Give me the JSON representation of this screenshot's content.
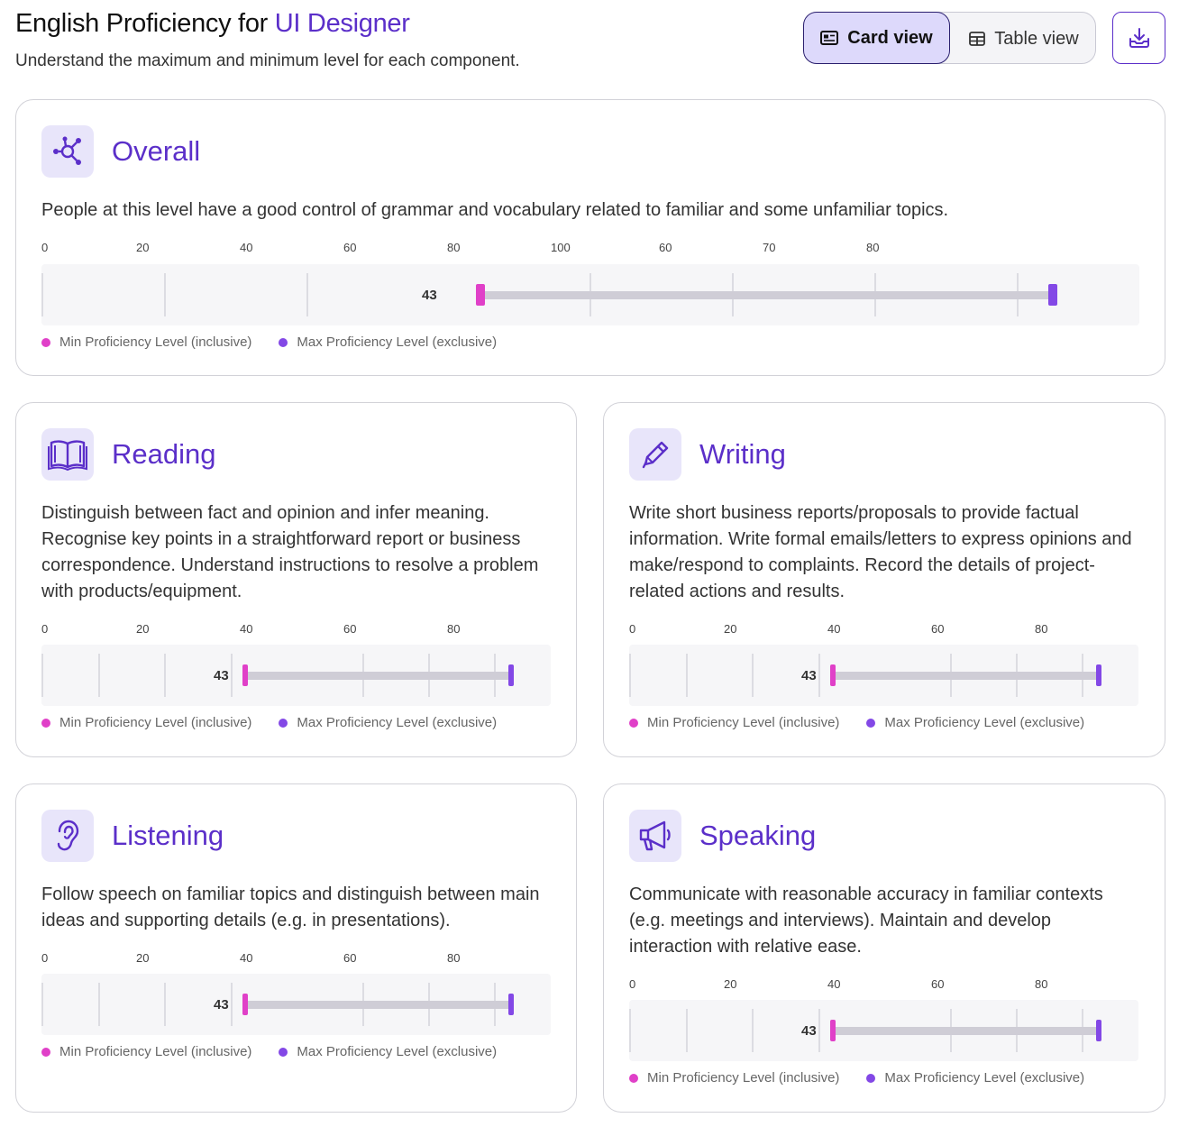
{
  "header": {
    "title_prefix": "English Proficiency for ",
    "title_role": "UI Designer",
    "subtitle": "Understand the maximum and minimum level for each component."
  },
  "view_toggle": {
    "card_label": "Card view",
    "table_label": "Table view",
    "selected": "Card view"
  },
  "legend": {
    "min_label": "Min Proficiency Level (inclusive)",
    "max_label": "Max Proficiency Level (exclusive)"
  },
  "colors": {
    "accent": "#5b2fc9",
    "min_marker": "#e040c8",
    "max_marker": "#8348e6"
  },
  "overall": {
    "title": "Overall",
    "icon": "network-hub-icon",
    "description": "People at this level have a good control of grammar and vocabulary related to familiar and some unfamiliar topics.",
    "scale_ticks": [
      "0",
      "20",
      "40",
      "60",
      "80",
      "100",
      "60",
      "70",
      "80"
    ],
    "value_label": "43"
  },
  "components": [
    {
      "title": "Reading",
      "icon": "open-book-icon",
      "description": "Distinguish between fact and opinion and infer meaning. Recognise key points in a straightforward report or business correspondence. Understand instructions to resolve a problem with products/equipment.",
      "scale_ticks": [
        "0",
        "20",
        "40",
        "60",
        "80"
      ],
      "value_label": "43"
    },
    {
      "title": "Writing",
      "icon": "pencil-icon",
      "description": "Write short business reports/proposals to provide factual information. Write formal emails/letters to express opinions and make/respond to complaints. Record the details of project-related actions and results.",
      "scale_ticks": [
        "0",
        "20",
        "40",
        "60",
        "80"
      ],
      "value_label": "43"
    },
    {
      "title": "Listening",
      "icon": "ear-icon",
      "description": "Follow speech on familiar topics and distinguish between main ideas and supporting details (e.g. in presentations).",
      "scale_ticks": [
        "0",
        "20",
        "40",
        "60",
        "80"
      ],
      "value_label": "43"
    },
    {
      "title": "Speaking",
      "icon": "megaphone-icon",
      "description": "Communicate with reasonable accuracy in familiar contexts (e.g.  meetings and interviews). Maintain and develop interaction with relative ease.",
      "scale_ticks": [
        "0",
        "20",
        "40",
        "60",
        "80"
      ],
      "value_label": "43"
    }
  ]
}
